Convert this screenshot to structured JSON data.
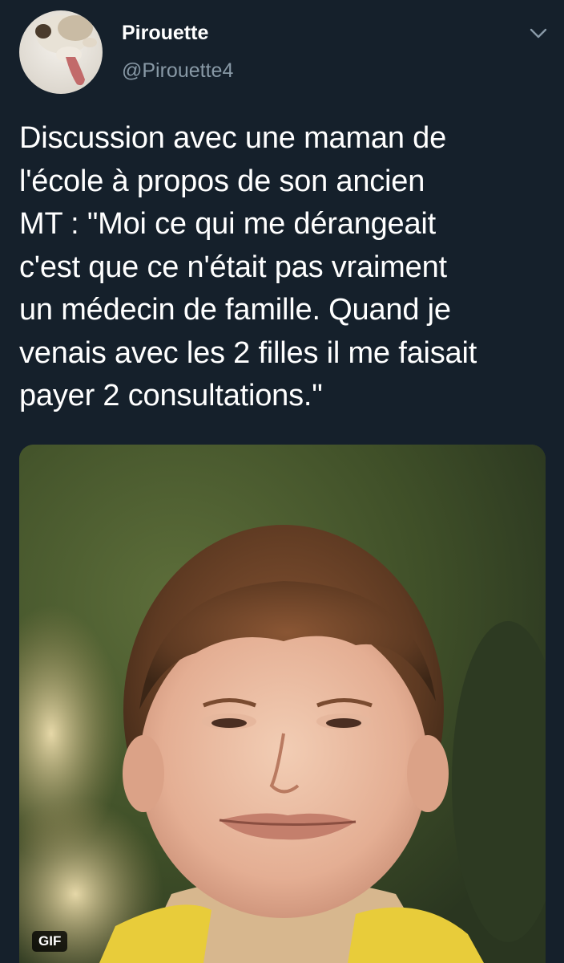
{
  "tweet": {
    "author": {
      "display_name": "Pirouette",
      "handle": "@Pirouette4",
      "avatar_icon": "llama-avatar-icon"
    },
    "menu_icon": "chevron-down-icon",
    "text": "Discussion avec une maman de\nl'école à propos de son ancien\nMT : \"Moi ce qui me dérangeait\nc'est que ce n'était pas vraiment\nun médecin de famille. Quand je\nvenais avec les 2 filles il me faisait\npayer 2 consultations.\"",
    "media": {
      "type": "gif",
      "badge": "GIF",
      "description_icon": "awkward-boy-gif-image"
    }
  },
  "colors": {
    "background": "#15202b",
    "text_primary": "#ffffff",
    "text_secondary": "#8899a6"
  }
}
